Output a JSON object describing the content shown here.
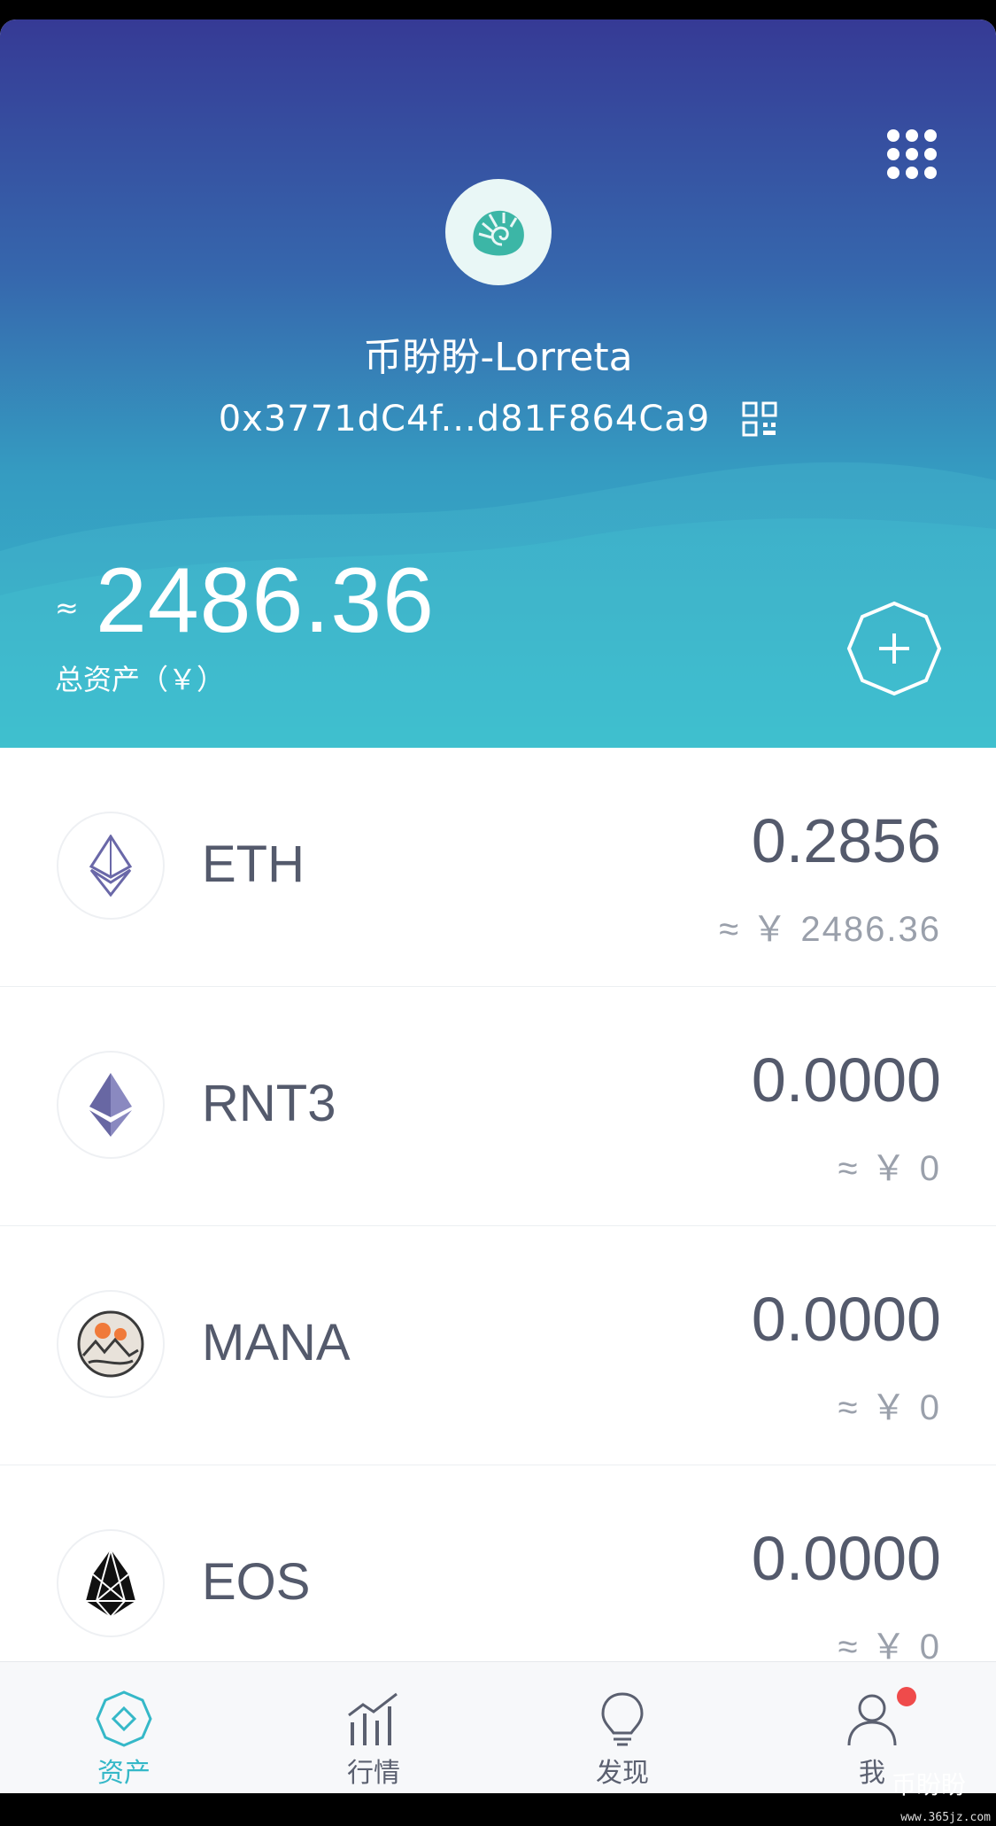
{
  "header": {
    "wallet_name": "币盼盼-Lorreta",
    "address": "0x3771dC4f...d81F864Ca9",
    "approx_symbol": "≈",
    "total_assets": "2486.36",
    "total_label": "总资产（￥）"
  },
  "assets": [
    {
      "symbol": "ETH",
      "amount": "0.2856",
      "value": "≈ ￥ 2486.36",
      "icon": "eth-icon"
    },
    {
      "symbol": "RNT3",
      "amount": "0.0000",
      "value": "≈ ￥ 0",
      "icon": "rnt3-icon"
    },
    {
      "symbol": "MANA",
      "amount": "0.0000",
      "value": "≈ ￥ 0",
      "icon": "mana-icon"
    },
    {
      "symbol": "EOS",
      "amount": "0.0000",
      "value": "≈ ￥ 0",
      "icon": "eos-icon"
    }
  ],
  "tabs": [
    {
      "label": "资产",
      "icon": "assets-icon",
      "active": true
    },
    {
      "label": "行情",
      "icon": "market-chart-icon",
      "active": false
    },
    {
      "label": "发现",
      "icon": "lightbulb-icon",
      "active": false
    },
    {
      "label": "我",
      "icon": "user-icon",
      "active": false,
      "badge": true
    }
  ],
  "watermark": {
    "text": "币盼盼",
    "url": "www.365jz.com"
  },
  "colors": {
    "accent": "#35b8c8",
    "header_top": "#363a95",
    "header_bottom": "#37bbcb",
    "text_primary": "#545a6c",
    "text_secondary": "#9aa0ab",
    "badge": "#ef4b4b"
  }
}
